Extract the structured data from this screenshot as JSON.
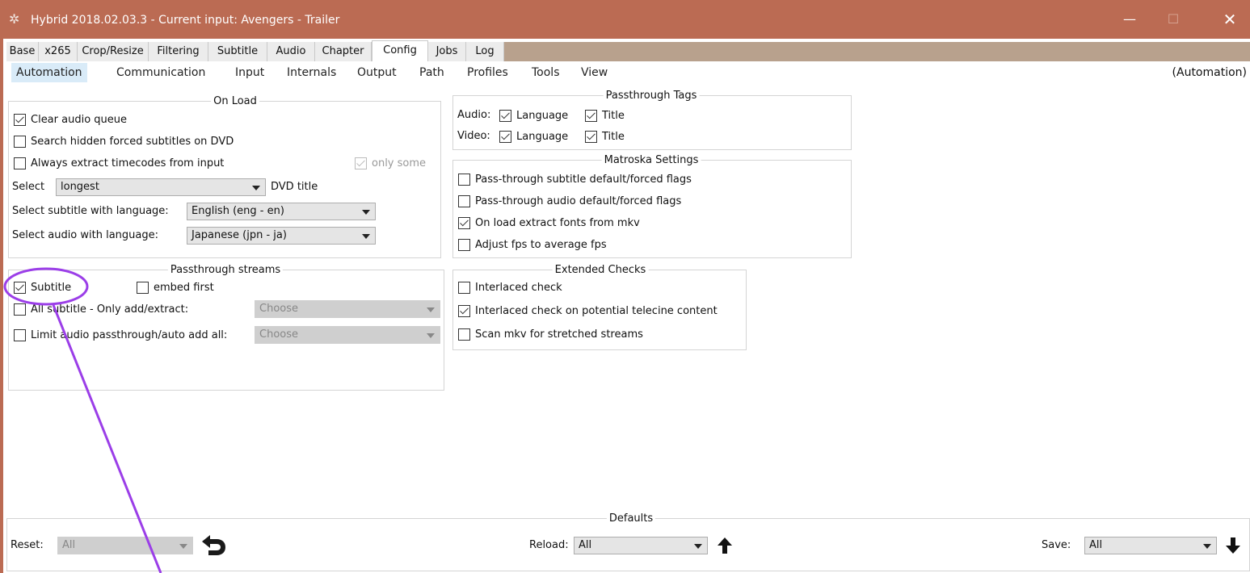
{
  "window": {
    "title": "Hybrid 2018.02.03.3 - Current input: Avengers - Trailer",
    "buttons": {
      "minimize": "—",
      "maximize": "☐",
      "close": "✕"
    }
  },
  "tabs": [
    "Base",
    "x265",
    "Crop/Resize",
    "Filtering",
    "Subtitle",
    "Audio",
    "Chapter",
    "Config",
    "Jobs",
    "Log"
  ],
  "active_tab": "Config",
  "subtabs": [
    "Automation",
    "Communication",
    "Input",
    "Internals",
    "Output",
    "Path",
    "Profiles",
    "Tools",
    "View"
  ],
  "active_subtab": "Automation",
  "subtab_hint": "(Automation)",
  "on_load": {
    "title": "On Load",
    "clear_audio_queue": {
      "label": "Clear audio queue",
      "checked": true
    },
    "search_hidden": {
      "label": "Search hidden forced subtitles on DVD",
      "checked": false
    },
    "always_extract": {
      "label": "Always extract timecodes from input",
      "checked": false
    },
    "only_some": {
      "label": "only some",
      "checked": true,
      "enabled": false
    },
    "select_label": "Select",
    "select_value": "longest",
    "dvd_title": "DVD title",
    "subtitle_lang_label": "Select subtitle with language:",
    "subtitle_lang_value": "English (eng - en)",
    "audio_lang_label": "Select audio with language:",
    "audio_lang_value": "Japanese (jpn - ja)"
  },
  "passthrough_streams": {
    "title": "Passthrough streams",
    "subtitle": {
      "label": "Subtitle",
      "checked": true
    },
    "embed_first": {
      "label": "embed first",
      "checked": false
    },
    "all_subtitle": {
      "label": "All subtitle - Only add/extract:",
      "checked": false
    },
    "all_subtitle_value": "Choose",
    "limit_audio": {
      "label": "Limit audio passthrough/auto add all:",
      "checked": false
    },
    "limit_audio_value": "Choose"
  },
  "passthrough_tags": {
    "title": "Passthrough Tags",
    "audio_label": "Audio:",
    "video_label": "Video:",
    "audio_language": {
      "label": "Language",
      "checked": true
    },
    "audio_title": {
      "label": "Title",
      "checked": true
    },
    "video_language": {
      "label": "Language",
      "checked": true
    },
    "video_title": {
      "label": "Title",
      "checked": true
    }
  },
  "matroska": {
    "title": "Matroska Settings",
    "items": [
      {
        "label": "Pass-through subtitle default/forced flags",
        "checked": false
      },
      {
        "label": "Pass-through audio default/forced flags",
        "checked": false
      },
      {
        "label": "On load extract fonts from mkv",
        "checked": true
      },
      {
        "label": "Adjust fps to average fps",
        "checked": false
      }
    ]
  },
  "extended_checks": {
    "title": "Extended Checks",
    "items": [
      {
        "label": "Interlaced check",
        "checked": false
      },
      {
        "label": "Interlaced check on potential telecine content",
        "checked": true
      },
      {
        "label": "Scan mkv for stretched  streams",
        "checked": false
      }
    ]
  },
  "defaults": {
    "title": "Defaults",
    "reset_label": "Reset:",
    "reset_value": "All",
    "reload_label": "Reload:",
    "reload_value": "All",
    "save_label": "Save:",
    "save_value": "All"
  },
  "colors": {
    "titlebar": "#bb6b53",
    "annotation": "#9b3ee8",
    "tabbar": "#b8a18d",
    "subtab_active": "#d9ebf8"
  }
}
